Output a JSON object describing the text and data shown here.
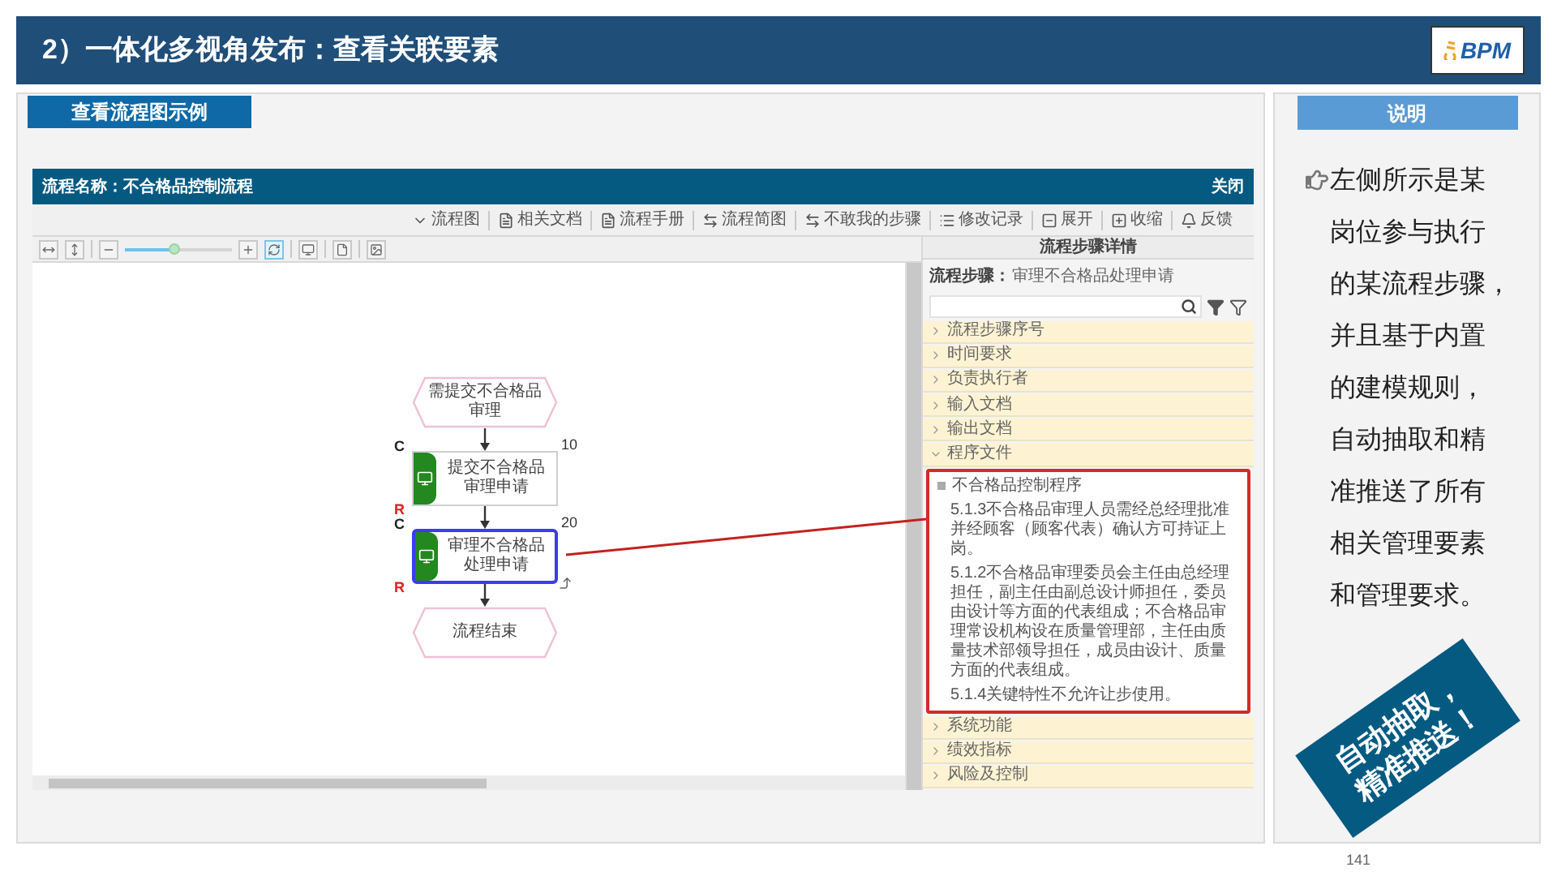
{
  "slide_title": "2）一体化多视角发布：查看关联要素",
  "logo": {
    "text": "BPM"
  },
  "example_tab": "查看流程图示例",
  "app": {
    "title": "流程名称：不合格品控制流程",
    "close": "关闭",
    "toolbar": [
      {
        "label": "流程图"
      },
      {
        "label": "相关文档"
      },
      {
        "label": "流程手册"
      },
      {
        "label": "流程简图"
      },
      {
        "label": "不敢我的步骤"
      },
      {
        "label": "修改记录"
      },
      {
        "label": "展开"
      },
      {
        "label": "收缩"
      },
      {
        "label": "反馈"
      }
    ],
    "zoom_slider": {
      "level": 0.45
    },
    "diagram": {
      "nodes": [
        {
          "kind": "event",
          "label": "需提交不合格品审理"
        },
        {
          "kind": "function",
          "label": "提交不合格品审理申请",
          "selected": false,
          "role_top": "C",
          "role_bottom": "R",
          "number": "10"
        },
        {
          "kind": "function",
          "label": "审理不合格品处理申请",
          "selected": true,
          "role_top": "C",
          "role_bottom": "R",
          "number": "20"
        },
        {
          "kind": "event",
          "label": "流程结束"
        }
      ]
    },
    "details": {
      "header": "流程步骤详情",
      "step_label": "流程步骤：",
      "step_value": "审理不合格品处理申请",
      "sections": [
        {
          "title": "流程步骤序号",
          "expanded": false
        },
        {
          "title": "时间要求",
          "expanded": false
        },
        {
          "title": "负责执行者",
          "expanded": false
        },
        {
          "title": "输入文档",
          "expanded": false
        },
        {
          "title": "输出文档",
          "expanded": false
        },
        {
          "title": "程序文件",
          "expanded": true,
          "document": {
            "title": "不合格品控制程序",
            "paragraphs": [
              "5.1.3不合格品审理人员需经总经理批准并经顾客（顾客代表）确认方可持证上岗。",
              "5.1.2不合格品审理委员会主任由总经理担任，副主任由副总设计师担任，委员由设计等方面的代表组成；不合格品审理常设机构设在质量管理部，主任由质量技术部领导担任，成员由设计、质量方面的代表组成。",
              "5.1.4关键特性不允许让步使用。"
            ]
          }
        },
        {
          "title": "系统功能",
          "expanded": false
        },
        {
          "title": "绩效指标",
          "expanded": false
        },
        {
          "title": "风险及控制",
          "expanded": false
        }
      ]
    }
  },
  "explanation": {
    "header": "说明",
    "lines": [
      "左侧所示是某",
      "岗位参与执行",
      "的某流程步骤，",
      "并且基于内置",
      "的建模规则，",
      "自动抽取和精",
      "准推送了所有",
      "相关管理要素",
      "和管理要求。"
    ]
  },
  "stamp": {
    "lines": [
      "自动抽取，",
      "精准推送！"
    ]
  },
  "page_number": "141"
}
